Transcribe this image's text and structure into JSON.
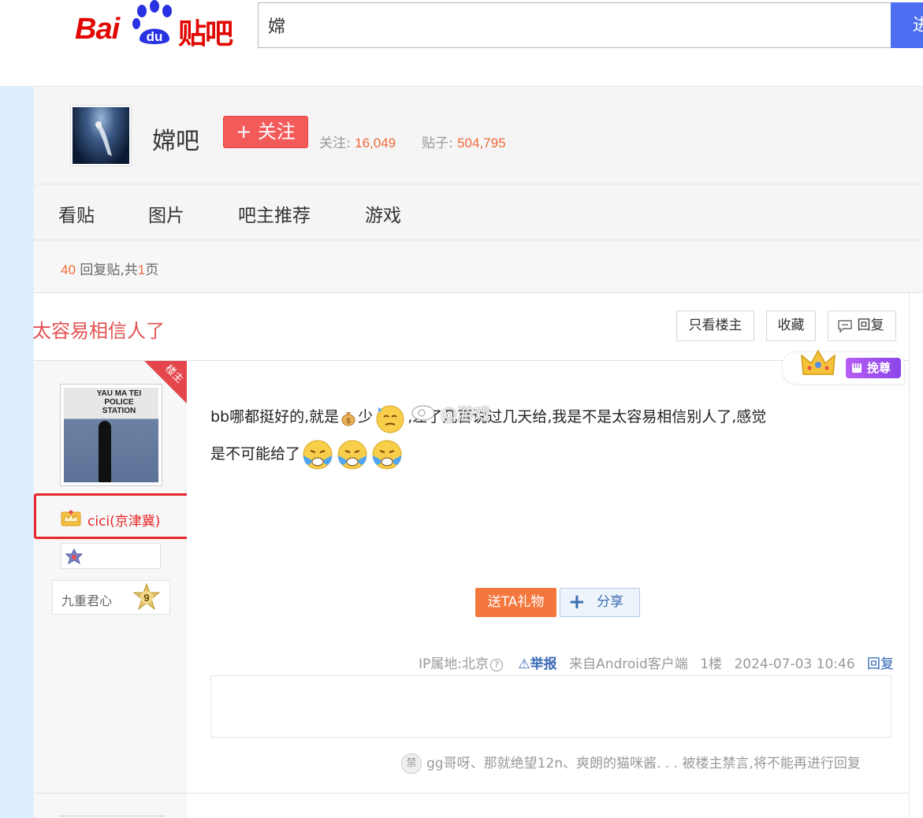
{
  "header": {
    "logo_bai": "Bai",
    "logo_du": "du",
    "logo_tieba": "贴吧",
    "search_value": "嫦",
    "search_button_label": "进"
  },
  "forum": {
    "name": "嫦吧",
    "follow_button": "+ 关注",
    "followers_label": "关注:",
    "followers_count": "16,049",
    "posts_label": "贴子:",
    "posts_count": "504,795"
  },
  "nav": {
    "tabs": [
      "看贴",
      "图片",
      "吧主推荐",
      "游戏"
    ]
  },
  "reply_bar": {
    "count": "40",
    "text_mid": " 回复贴,共",
    "pages": "1",
    "text_end": "页"
  },
  "thread": {
    "title": "太容易相信人了",
    "only_owner_button": "只看楼主",
    "favorite_button": "收藏",
    "reply_button": "回复"
  },
  "post": {
    "owner_badge": "楼主",
    "avatar_sign_text": "YAU MA TEI POLICE STATION",
    "author_name": "cici(京津冀)",
    "level_name": "九重君心",
    "level_number": "9",
    "crown_tag": "挽尊",
    "content_part1": "bb哪都挺好的,就是",
    "content_part2": "少",
    "content_part3": ",差了几百说过几天给,我是不是太容易相信别人了,感觉",
    "content_part4": "是不可能给了",
    "watermark": "@游戏",
    "gift_button": "送TA礼物",
    "share_button": "分享",
    "ip_label": "IP属地:北京",
    "report_label": "举报",
    "source": "来自Android客户端",
    "floor": "1楼",
    "datetime": "2024-07-03 10:46",
    "reply_link": "回复",
    "ban_icon_text": "禁",
    "ban_notice": "gg哥呀、那就绝望12n、爽朗的猫咪酱. . . 被楼主禁言,将不能再进行回复"
  },
  "colors": {
    "brand_red": "#e10602",
    "brand_blue": "#4e6ef2",
    "title_red": "#e35252",
    "stat_orange": "#f06a3a",
    "link_blue": "#2d64b3",
    "highlight_box": "#e8262a"
  }
}
